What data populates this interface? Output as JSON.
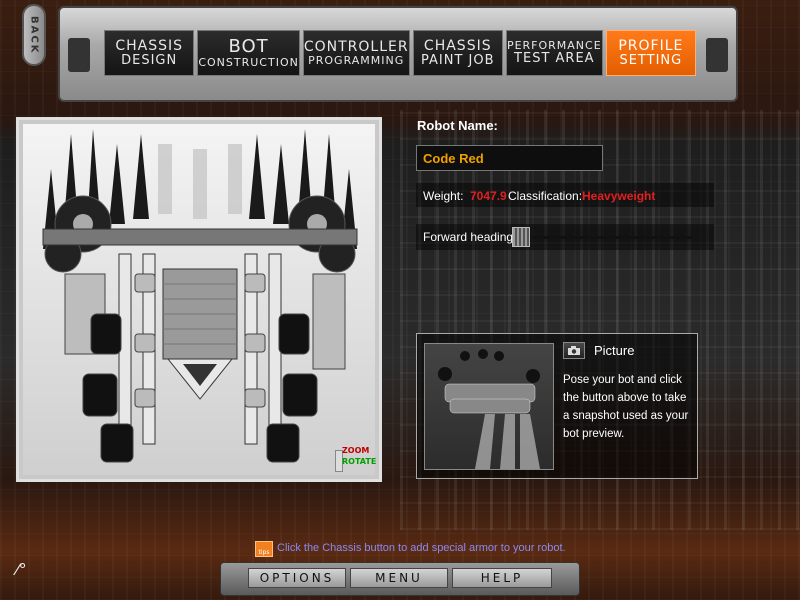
{
  "nav": {
    "back_label": "BACK",
    "tabs": [
      {
        "line1": "CHASSIS",
        "line2": "DESIGN",
        "active": false
      },
      {
        "line1": "BOT",
        "line2": "CONSTRUCTION",
        "active": false
      },
      {
        "line1": "CONTROLLER",
        "line2": "PROGRAMMING",
        "active": false
      },
      {
        "line1": "CHASSIS",
        "line2": "PAINT JOB",
        "active": false
      },
      {
        "line1": "PERFORMANCE",
        "line2": "TEST AREA",
        "active": false
      },
      {
        "line1": "PROFILE",
        "line2": "SETTING",
        "active": true
      }
    ]
  },
  "viewer": {
    "zoom_label": "ZOOM",
    "rotate_label": "ROTATE"
  },
  "profile": {
    "name_label": "Robot Name:",
    "name_value": "Code Red",
    "weight_label": "Weight:",
    "weight_value": "7047.9",
    "class_label": "Classification:",
    "class_value": "Heavyweight",
    "heading_label": "Forward heading:"
  },
  "picture": {
    "title": "Picture",
    "description": "Pose your bot and click the button above to take a snapshot used as your bot preview."
  },
  "tip": {
    "icon_label": "tips",
    "text": "Click the Chassis button to add special armor to your robot."
  },
  "bottom": {
    "options_label": "OPTIONS",
    "menu_label": "MENU",
    "help_label": "HELP"
  },
  "colors": {
    "accent_orange": "#f06a10",
    "warning_red": "#e02020",
    "name_gold": "#f0a000",
    "tip_blue": "#8a8af0"
  }
}
